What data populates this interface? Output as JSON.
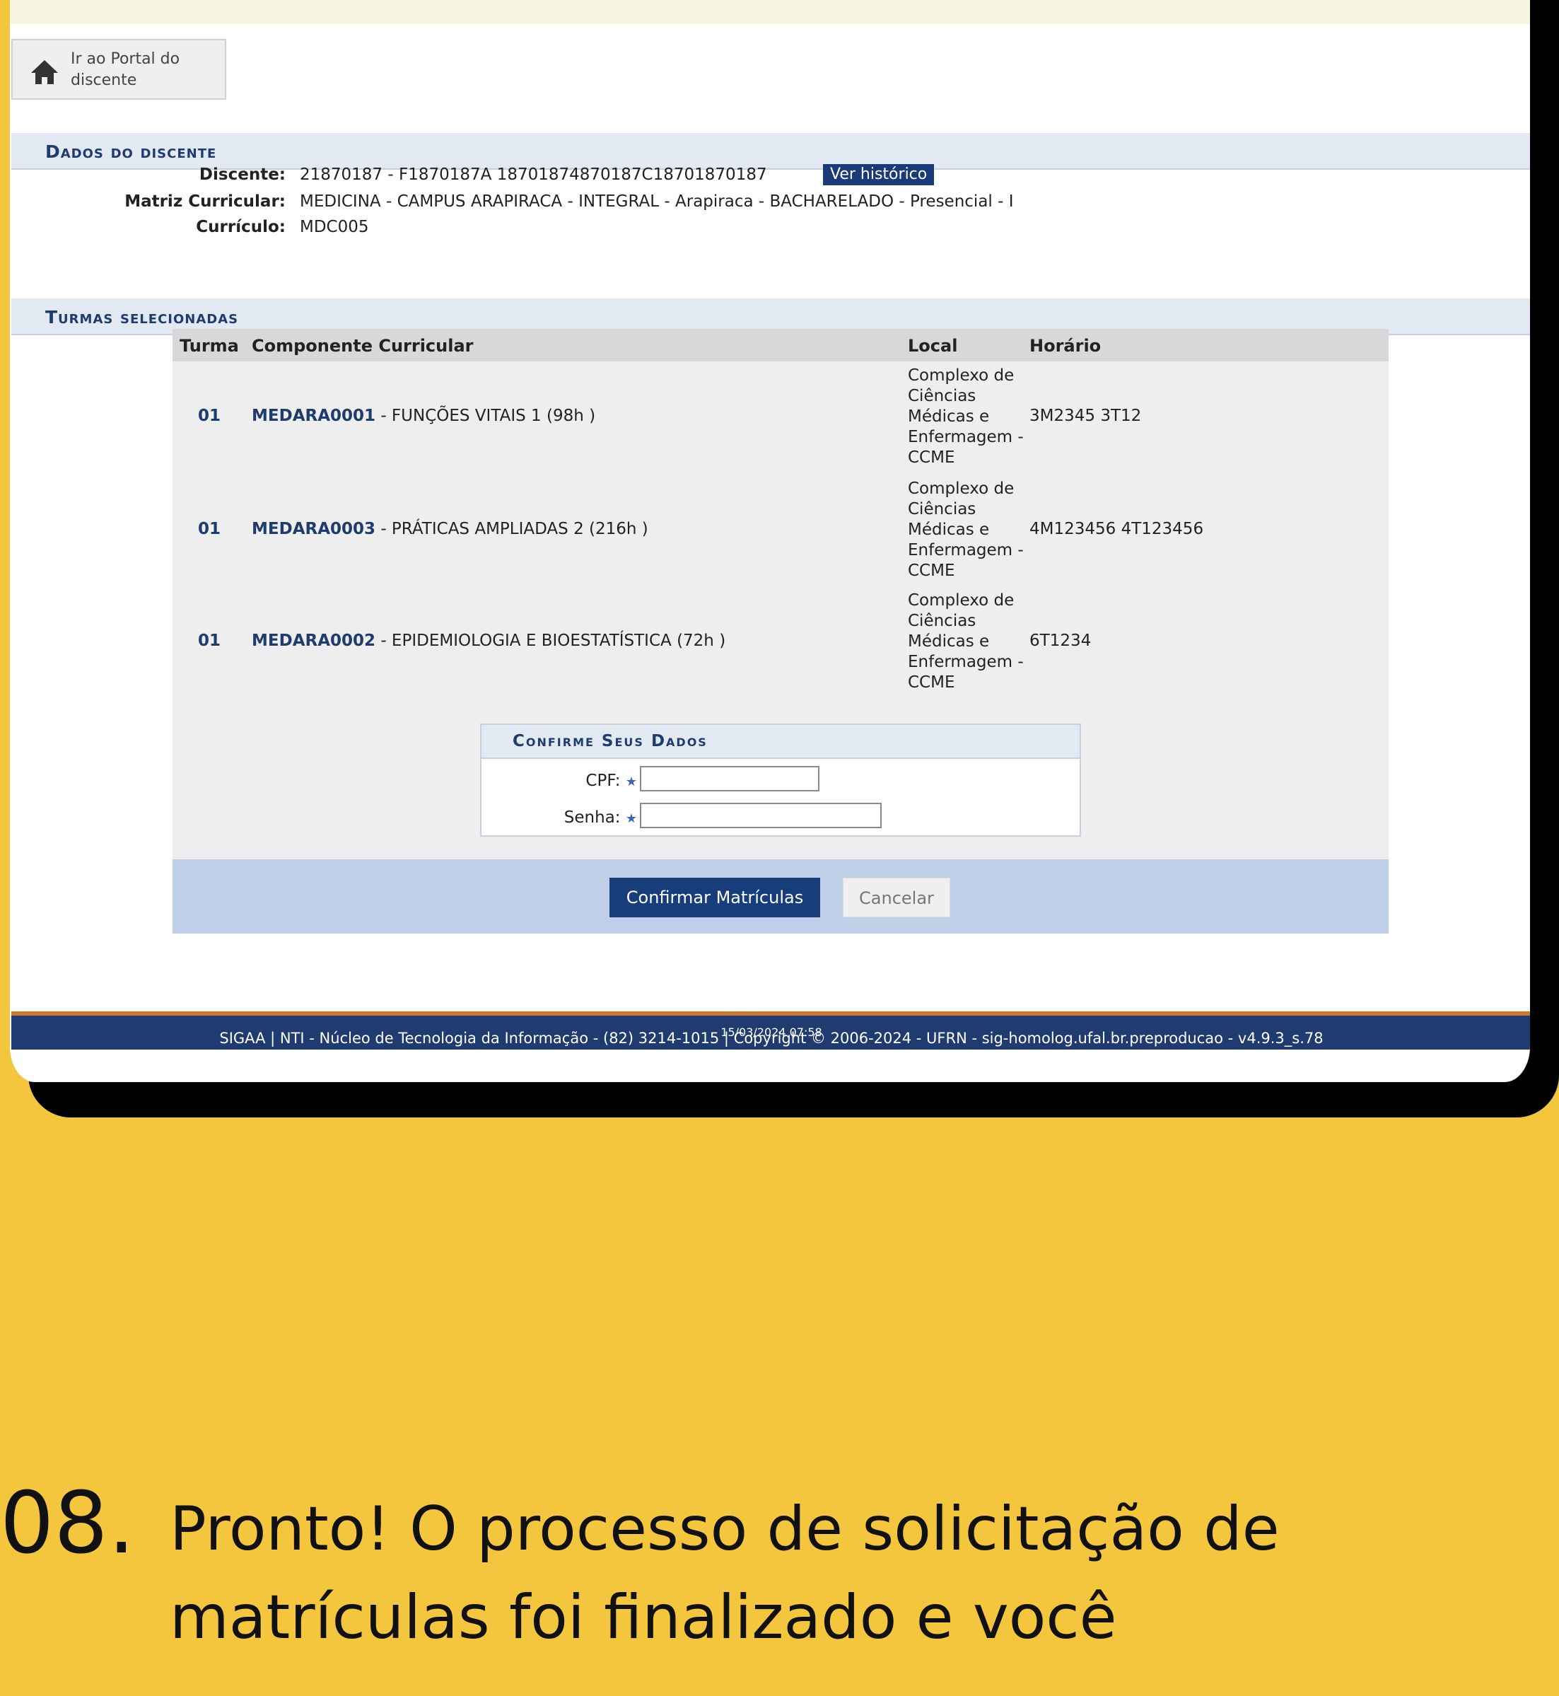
{
  "portal": {
    "label": "Ir ao Portal do discente"
  },
  "dados": {
    "header": "Dados do discente",
    "discente_label": "Discente:",
    "discente_value": "21870187 - F1870187A 18701874870187C18701870187",
    "ver_historico": "Ver histórico",
    "matriz_label": "Matriz Curricular:",
    "matriz_value": "MEDICINA - CAMPUS ARAPIRACA - INTEGRAL - Arapiraca - BACHARELADO - Presencial - I",
    "curriculo_label": "Currículo:",
    "curriculo_value": "MDC005"
  },
  "turmas": {
    "header": "Turmas selecionadas",
    "columns": {
      "turma": "Turma",
      "componente": "Componente Curricular",
      "local": "Local",
      "horario": "Horário"
    },
    "rows": [
      {
        "turma": "01",
        "codigo": "MEDARA0001",
        "nome": " - FUNÇÕES VITAIS 1 (98h )",
        "local": "Complexo de Ciências Médicas e Enfermagem - CCME",
        "horario": "3M2345 3T12"
      },
      {
        "turma": "01",
        "codigo": "MEDARA0003",
        "nome": " - PRÁTICAS AMPLIADAS 2 (216h )",
        "local": "Complexo de Ciências Médicas e Enfermagem - CCME",
        "horario": "4M123456 4T123456"
      },
      {
        "turma": "01",
        "codigo": "MEDARA0002",
        "nome": " - EPIDEMIOLOGIA E BIOESTATÍSTICA (72h )",
        "local": "Complexo de Ciências Médicas e Enfermagem - CCME",
        "horario": "6T1234"
      }
    ]
  },
  "confirm": {
    "header": "Confirme Seus Dados",
    "cpf_label": "CPF:",
    "senha_label": "Senha:",
    "cpf_value": "",
    "senha_value": ""
  },
  "actions": {
    "confirmar": "Confirmar Matrículas",
    "cancelar": "Cancelar"
  },
  "footer": {
    "text": "SIGAA | NTI - Núcleo de Tecnologia da Informação - (82) 3214-1015 | Copyright © 2006-2024 - UFRN - sig-homolog.ufal.br.preproducao - v4.9.3_s.78",
    "timestamp": "15/03/2024 07:58"
  },
  "step": {
    "number": "08.",
    "text": "Pronto! O processo de solicitação de matrículas foi finalizado e você"
  },
  "colors": {
    "background": "#f4c63d",
    "primary": "#173d7a",
    "header_text": "#1e3c6e"
  },
  "icons": {
    "portal": "home-icon",
    "required": "asterisk-icon"
  }
}
